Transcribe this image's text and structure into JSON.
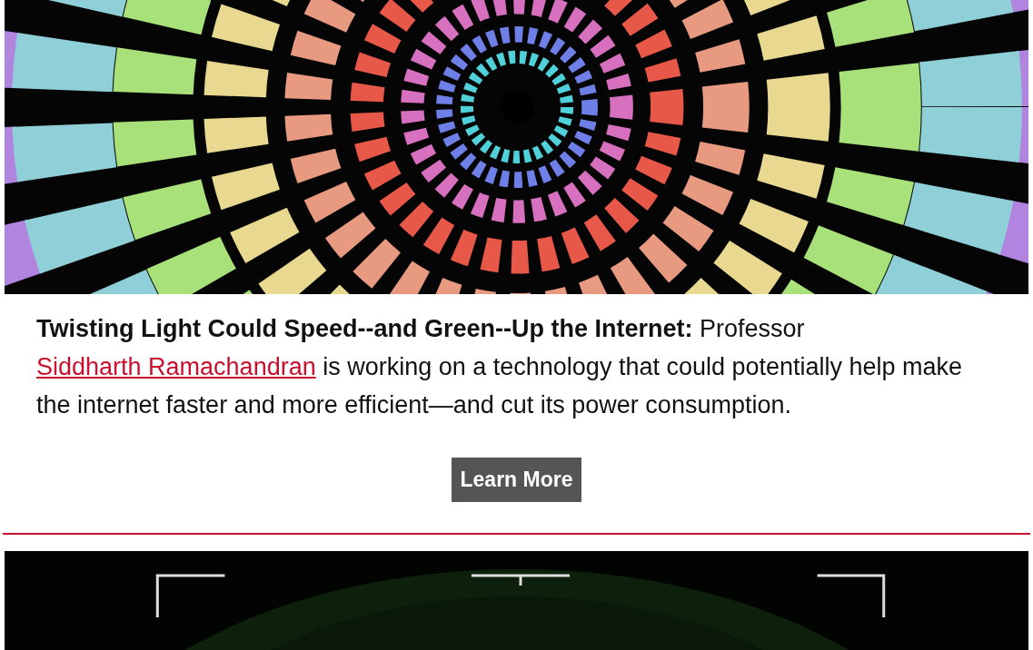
{
  "story": {
    "text_before": "**Twisting Light Could Speed--and Green--Up the Internet:** Professor ",
    "link": "Siddharth Ramachandran",
    "text_after": " is working on a technology that could potentially help make the internet faster and more efficient—and cut its power consumption."
  },
  "button": "Learn More"
}
